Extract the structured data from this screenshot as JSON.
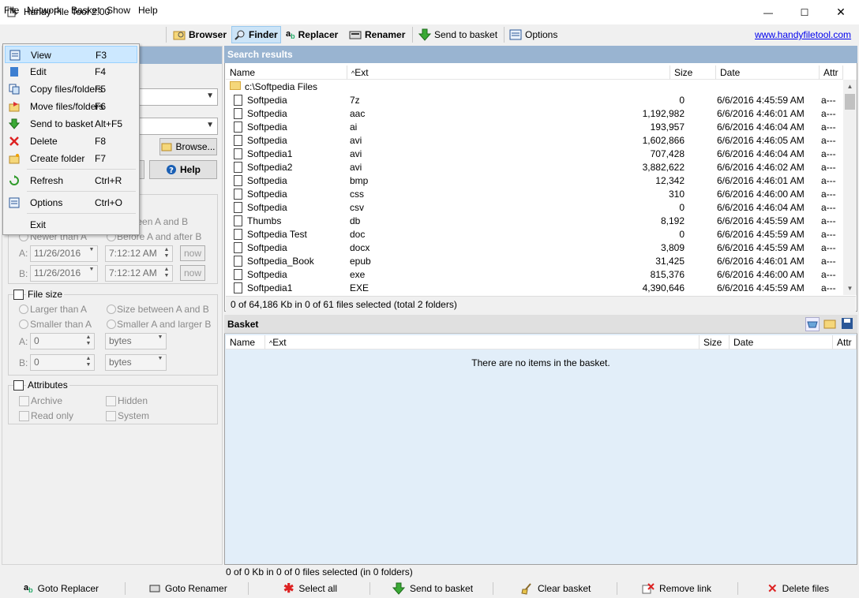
{
  "window": {
    "title": "Handy File Tool 2.00",
    "minimize": "—",
    "maximize": "☐",
    "close": "✕"
  },
  "menu": [
    "File",
    "Network",
    "Basket",
    "Show",
    "Help"
  ],
  "toolbar": {
    "browser": "Browser",
    "finder": "Finder",
    "replacer": "Replacer",
    "renamer": "Renamer",
    "send_to_basket": "Send to basket",
    "options": "Options",
    "website": "www.handyfiletool.com"
  },
  "file_menu": [
    {
      "label": "View",
      "shortcut": "F3",
      "icon": "view-icon"
    },
    {
      "label": "Edit",
      "shortcut": "F4",
      "icon": "edit-icon"
    },
    {
      "label": "Copy files/folders",
      "shortcut": "F5",
      "icon": "copy-icon"
    },
    {
      "label": "Move files/folders",
      "shortcut": "F6",
      "icon": "move-icon"
    },
    {
      "label": "Send to basket",
      "shortcut": "Alt+F5",
      "icon": "send-to-basket-icon"
    },
    {
      "label": "Delete",
      "shortcut": "F8",
      "icon": "delete-icon"
    },
    {
      "label": "Create folder",
      "shortcut": "F7",
      "icon": "create-folder-icon"
    },
    {
      "label": "Refresh",
      "shortcut": "Ctrl+R",
      "icon": "refresh-icon"
    },
    {
      "label": "Options",
      "shortcut": "Ctrl+O",
      "icon": "options-icon"
    },
    {
      "label": "Exit",
      "shortcut": "",
      "icon": ""
    }
  ],
  "left": {
    "browse": "Browse...",
    "help": "Help",
    "date": {
      "between": "between A and B",
      "newer": "Newer than A",
      "before_after": "Before A and after B",
      "a_label": "A:",
      "b_label": "B:",
      "a_date": "11/26/2016",
      "a_time": "7:12:12 AM",
      "b_date": "11/26/2016",
      "b_time": "7:12:12 AM",
      "now": "now"
    },
    "filesize": {
      "title": "File size",
      "larger": "Larger than A",
      "between": "Size between A and B",
      "smaller": "Smaller than A",
      "smaller_larger": "Smaller A and larger B",
      "a_label": "A:",
      "b_label": "B:",
      "a_value": "0",
      "b_value": "0",
      "unit_a": "bytes",
      "unit_b": "bytes"
    },
    "attributes": {
      "title": "Attributes",
      "archive": "Archive",
      "hidden": "Hidden",
      "readonly": "Read only",
      "system": "System"
    }
  },
  "results": {
    "title": "Search results",
    "columns": {
      "name": "Name",
      "ext": "Ext",
      "size": "Size",
      "date": "Date",
      "attr": "Attr"
    },
    "folder": "c:\\Softpedia Files",
    "rows": [
      {
        "name": "Softpedia",
        "ext": "7z",
        "size": "0",
        "date": "6/6/2016 4:45:59 AM",
        "attr": "a---"
      },
      {
        "name": "Softpedia",
        "ext": "aac",
        "size": "1,192,982",
        "date": "6/6/2016 4:46:01 AM",
        "attr": "a---"
      },
      {
        "name": "Softpedia",
        "ext": "ai",
        "size": "193,957",
        "date": "6/6/2016 4:46:04 AM",
        "attr": "a---"
      },
      {
        "name": "Softpedia",
        "ext": "avi",
        "size": "1,602,866",
        "date": "6/6/2016 4:46:05 AM",
        "attr": "a---"
      },
      {
        "name": "Softpedia1",
        "ext": "avi",
        "size": "707,428",
        "date": "6/6/2016 4:46:04 AM",
        "attr": "a---"
      },
      {
        "name": "Softpedia2",
        "ext": "avi",
        "size": "3,882,622",
        "date": "6/6/2016 4:46:02 AM",
        "attr": "a---"
      },
      {
        "name": "Softpedia",
        "ext": "bmp",
        "size": "12,342",
        "date": "6/6/2016 4:46:01 AM",
        "attr": "a---"
      },
      {
        "name": "Softpedia",
        "ext": "css",
        "size": "310",
        "date": "6/6/2016 4:46:00 AM",
        "attr": "a---"
      },
      {
        "name": "Softpedia",
        "ext": "csv",
        "size": "0",
        "date": "6/6/2016 4:46:04 AM",
        "attr": "a---"
      },
      {
        "name": "Thumbs",
        "ext": "db",
        "size": "8,192",
        "date": "6/6/2016 4:45:59 AM",
        "attr": "a---"
      },
      {
        "name": "Softpedia Test",
        "ext": "doc",
        "size": "0",
        "date": "6/6/2016 4:45:59 AM",
        "attr": "a---"
      },
      {
        "name": "Softpedia",
        "ext": "docx",
        "size": "3,809",
        "date": "6/6/2016 4:45:59 AM",
        "attr": "a---"
      },
      {
        "name": "Softpedia_Book",
        "ext": "epub",
        "size": "31,425",
        "date": "6/6/2016 4:46:01 AM",
        "attr": "a---"
      },
      {
        "name": "Softpedia",
        "ext": "exe",
        "size": "815,376",
        "date": "6/6/2016 4:46:00 AM",
        "attr": "a---"
      },
      {
        "name": "Softpedia1",
        "ext": "EXE",
        "size": "4,390,646",
        "date": "6/6/2016 4:45:59 AM",
        "attr": "a---"
      }
    ],
    "status": "0 of 64,186 Kb in 0 of 61 files selected (total 2 folders)"
  },
  "basket": {
    "title": "Basket",
    "columns": {
      "name": "Name",
      "ext": "Ext",
      "size": "Size",
      "date": "Date",
      "attr": "Attr"
    },
    "empty": "There are no items in the basket.",
    "status": "0 of 0 Kb in 0 of 0 files selected (in 0 folders)"
  },
  "bottom": [
    "Goto Replacer",
    "Goto Renamer",
    "Select all",
    "Send to basket",
    "Clear basket",
    "Remove link",
    "Delete files"
  ],
  "colors": {
    "accent": "#99b4d1",
    "selection": "#cce8ff",
    "basket_bg": "#e2eef9"
  }
}
